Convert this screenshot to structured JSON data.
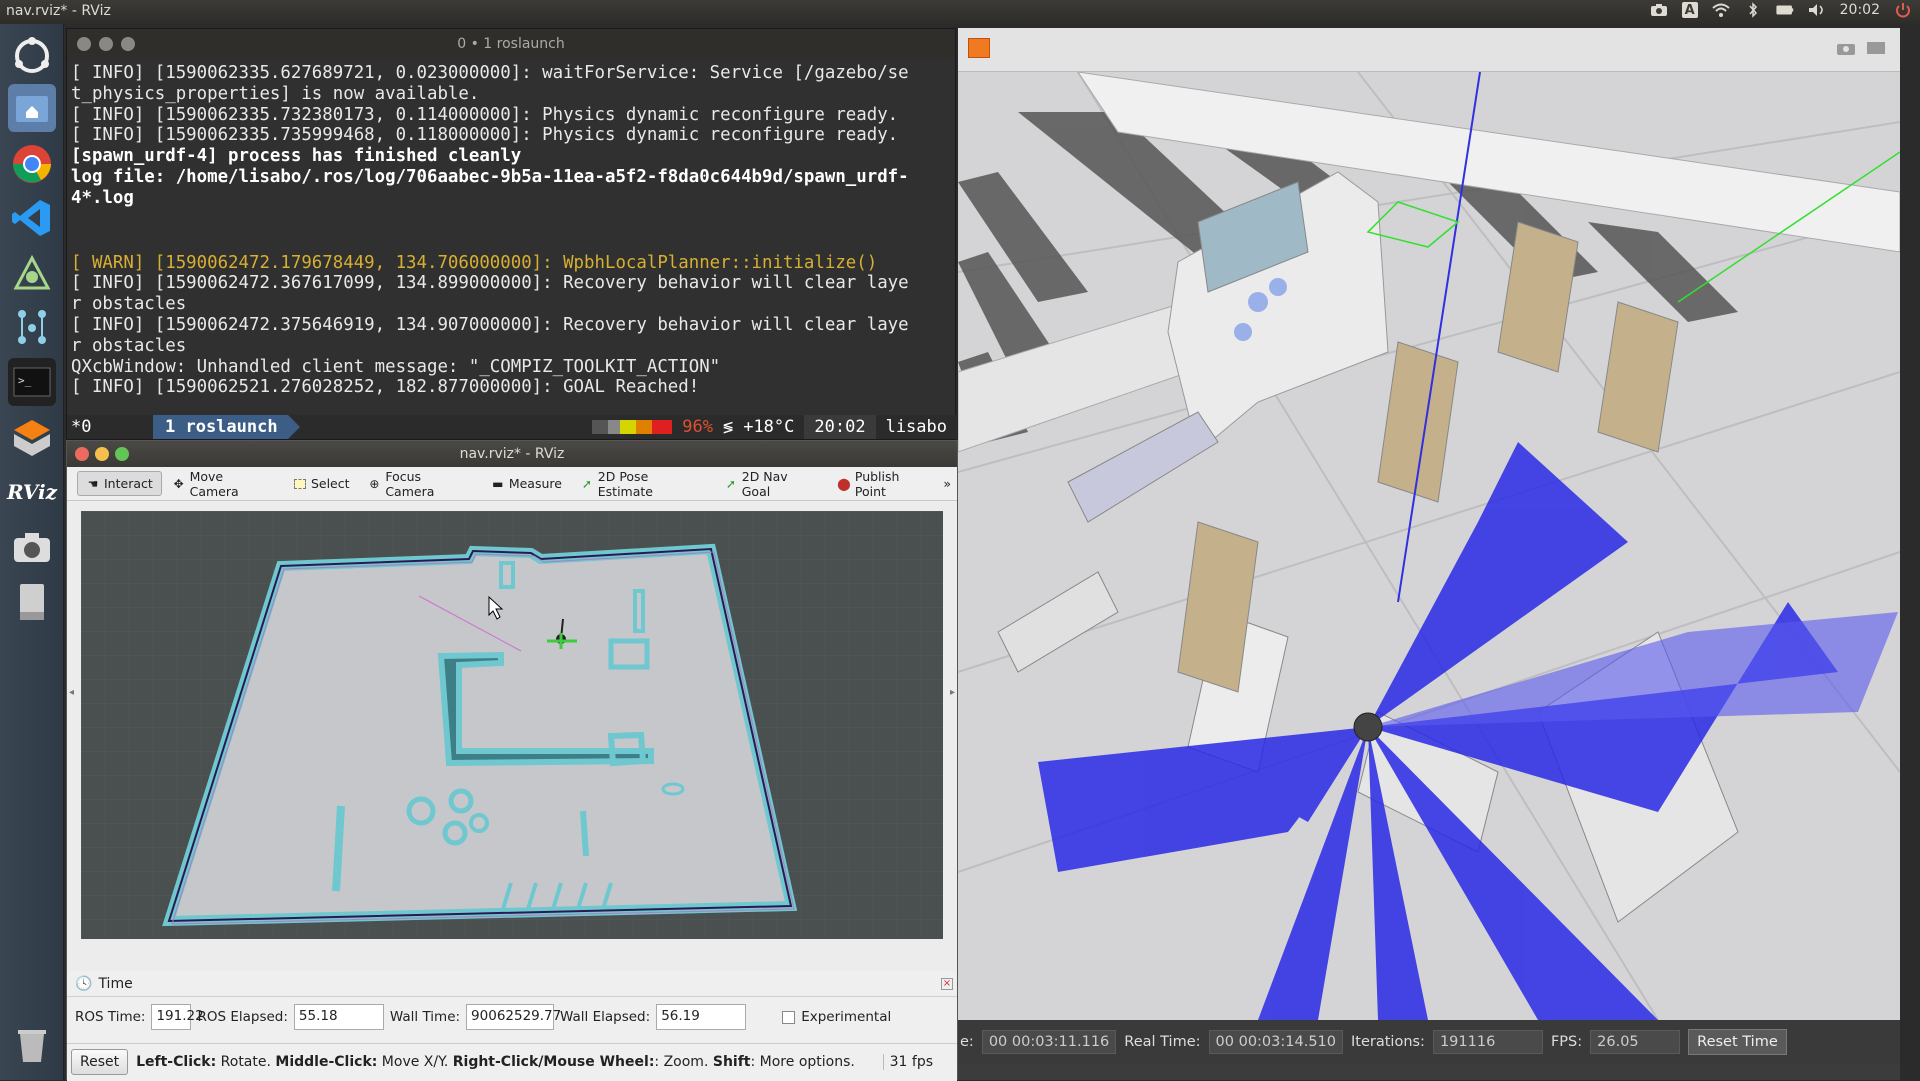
{
  "topbar": {
    "title": "nav.rviz* - RViz",
    "time": "20:02",
    "icons": [
      "camera-icon",
      "keyboard-indicator-icon",
      "wifi-icon",
      "bluetooth-icon",
      "battery-icon",
      "volume-icon",
      "power-icon"
    ],
    "keyboard": "A"
  },
  "launcher": {
    "items": [
      "ubuntu-dash-icon",
      "files-home-icon",
      "chrome-icon",
      "vscode-icon",
      "ros-turtle-icon",
      "network-graph-icon",
      "terminal-icon",
      "gazebo-icon",
      "rviz-icon",
      "camera-app-icon",
      "drive-icon",
      "trash-icon"
    ],
    "rviz_label": "RViz"
  },
  "terminal": {
    "title": "0 • 1 roslaunch",
    "lines": [
      {
        "text": "[ INFO] [1590062335.627689721, 0.023000000]: waitForService: Service [/gazebo/se",
        "style": ""
      },
      {
        "text": "t_physics_properties] is now available.",
        "style": ""
      },
      {
        "text": "[ INFO] [1590062335.732380173, 0.114000000]: Physics dynamic reconfigure ready.",
        "style": ""
      },
      {
        "text": "[ INFO] [1590062335.735999468, 0.118000000]: Physics dynamic reconfigure ready.",
        "style": ""
      },
      {
        "text": "[spawn_urdf-4] process has finished cleanly",
        "style": "b"
      },
      {
        "text": "log file: /home/lisabo/.ros/log/706aabec-9b5a-11ea-a5f2-f8da0c644b9d/spawn_urdf-",
        "style": "b"
      },
      {
        "text": "4*.log",
        "style": "b"
      },
      {
        "text": "",
        "style": "sep"
      },
      {
        "text": "",
        "style": "sep"
      },
      {
        "text": "[ WARN] [1590062472.179678449, 134.706000000]: WpbhLocalPlanner::initialize()",
        "style": "warn"
      },
      {
        "text": "[ INFO] [1590062472.367617099, 134.899000000]: Recovery behavior will clear laye",
        "style": ""
      },
      {
        "text": "r obstacles",
        "style": ""
      },
      {
        "text": "[ INFO] [1590062472.375646919, 134.907000000]: Recovery behavior will clear laye",
        "style": ""
      },
      {
        "text": "r obstacles",
        "style": ""
      },
      {
        "text": "QXcbWindow: Unhandled client message: \"_COMPIZ_TOOLKIT_ACTION\"",
        "style": ""
      },
      {
        "text": "[ INFO] [1590062521.276028252, 182.877000000]: GOAL Reached!",
        "style": ""
      }
    ],
    "tmux": {
      "session": "*0",
      "window": "1 roslaunch",
      "cpu": "96%",
      "weather": "+18°C",
      "clock": "20:02",
      "user": "lisabo"
    }
  },
  "rviz": {
    "title": "nav.rviz* - RViz",
    "tools": [
      {
        "label": "Interact",
        "icon": "hand-cursor-icon",
        "active": true
      },
      {
        "label": "Move Camera",
        "icon": "move-camera-icon",
        "active": false
      },
      {
        "label": "Select",
        "icon": "select-box-icon",
        "active": false
      },
      {
        "label": "Focus Camera",
        "icon": "focus-camera-icon",
        "active": false
      },
      {
        "label": "Measure",
        "icon": "measure-icon",
        "active": false
      },
      {
        "label": "2D Pose Estimate",
        "icon": "pose-arrow-icon",
        "active": false
      },
      {
        "label": "2D Nav Goal",
        "icon": "nav-goal-arrow-icon",
        "active": false
      },
      {
        "label": "Publish Point",
        "icon": "map-pin-icon",
        "active": false
      }
    ],
    "time_panel": {
      "title": "Time",
      "ros_time_label": "ROS Time:",
      "ros_time": "191.22",
      "ros_elapsed_label": "ROS Elapsed:",
      "ros_elapsed": "55.18",
      "wall_time_label": "Wall Time:",
      "wall_time": "90062529.77",
      "wall_elapsed_label": "Wall Elapsed:",
      "wall_elapsed": "56.19",
      "experimental_label": "Experimental"
    },
    "status": {
      "reset": "Reset",
      "left_click": "Left-Click:",
      "left_click_desc": " Rotate. ",
      "middle_click": "Middle-Click:",
      "middle_click_desc": " Move X/Y. ",
      "right_click": "Right-Click/Mouse Wheel:",
      "right_click_desc": ": Zoom. ",
      "shift": "Shift",
      "shift_desc": ": More options.",
      "fps": "31 fps"
    }
  },
  "gazebo": {
    "status": {
      "sim_time_label": "e:",
      "sim_time": "00 00:03:11.116",
      "real_time_label": "Real Time:",
      "real_time": "00 00:03:14.510",
      "iterations_label": "Iterations:",
      "iterations": "191116",
      "fps_label": "FPS:",
      "fps": "26.05",
      "reset_time": "Reset Time"
    }
  },
  "colors": {
    "warn": "#d7af32",
    "tmux_window": "#3c5e86",
    "laser": "#2a2ae6",
    "costmap": "#6fc7cf"
  }
}
